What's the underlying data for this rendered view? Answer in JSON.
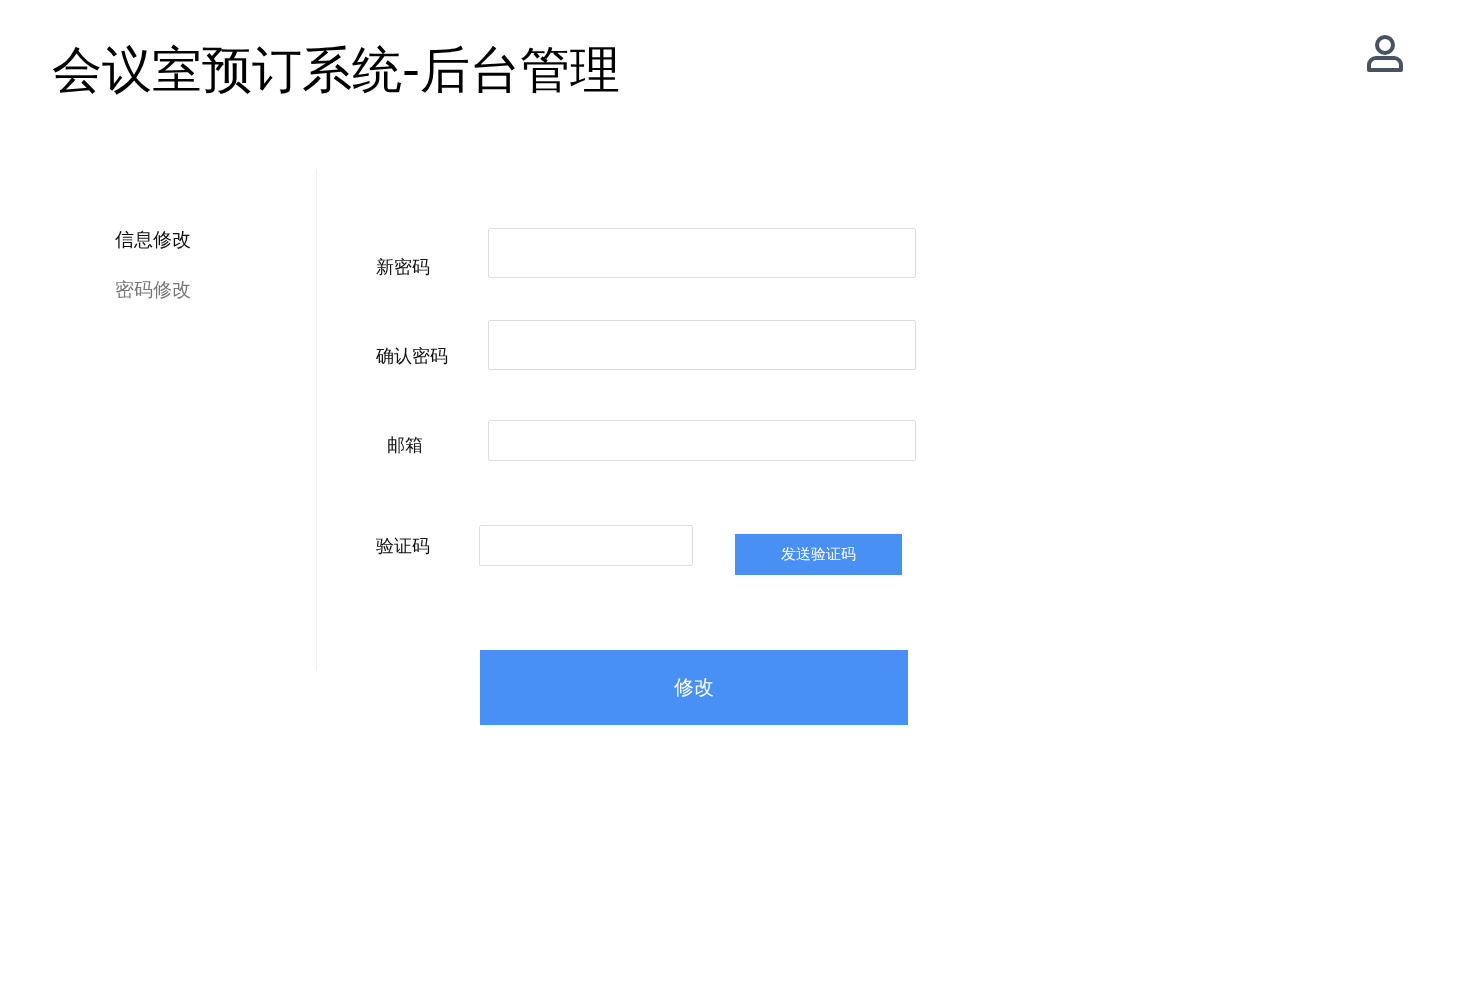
{
  "header": {
    "title": "会议室预订系统-后台管理"
  },
  "sidebar": {
    "items": [
      {
        "label": "信息修改",
        "selected": true
      },
      {
        "label": "密码修改",
        "selected": false
      }
    ]
  },
  "form": {
    "fields": [
      {
        "kind": "plain",
        "label": "新密码"
      },
      {
        "kind": "plain",
        "label": "确认密码"
      },
      {
        "kind": "plain",
        "label": "邮箱"
      },
      {
        "kind": "code",
        "label": "验证码",
        "button": "发送验证码"
      }
    ],
    "submit": "修改"
  }
}
